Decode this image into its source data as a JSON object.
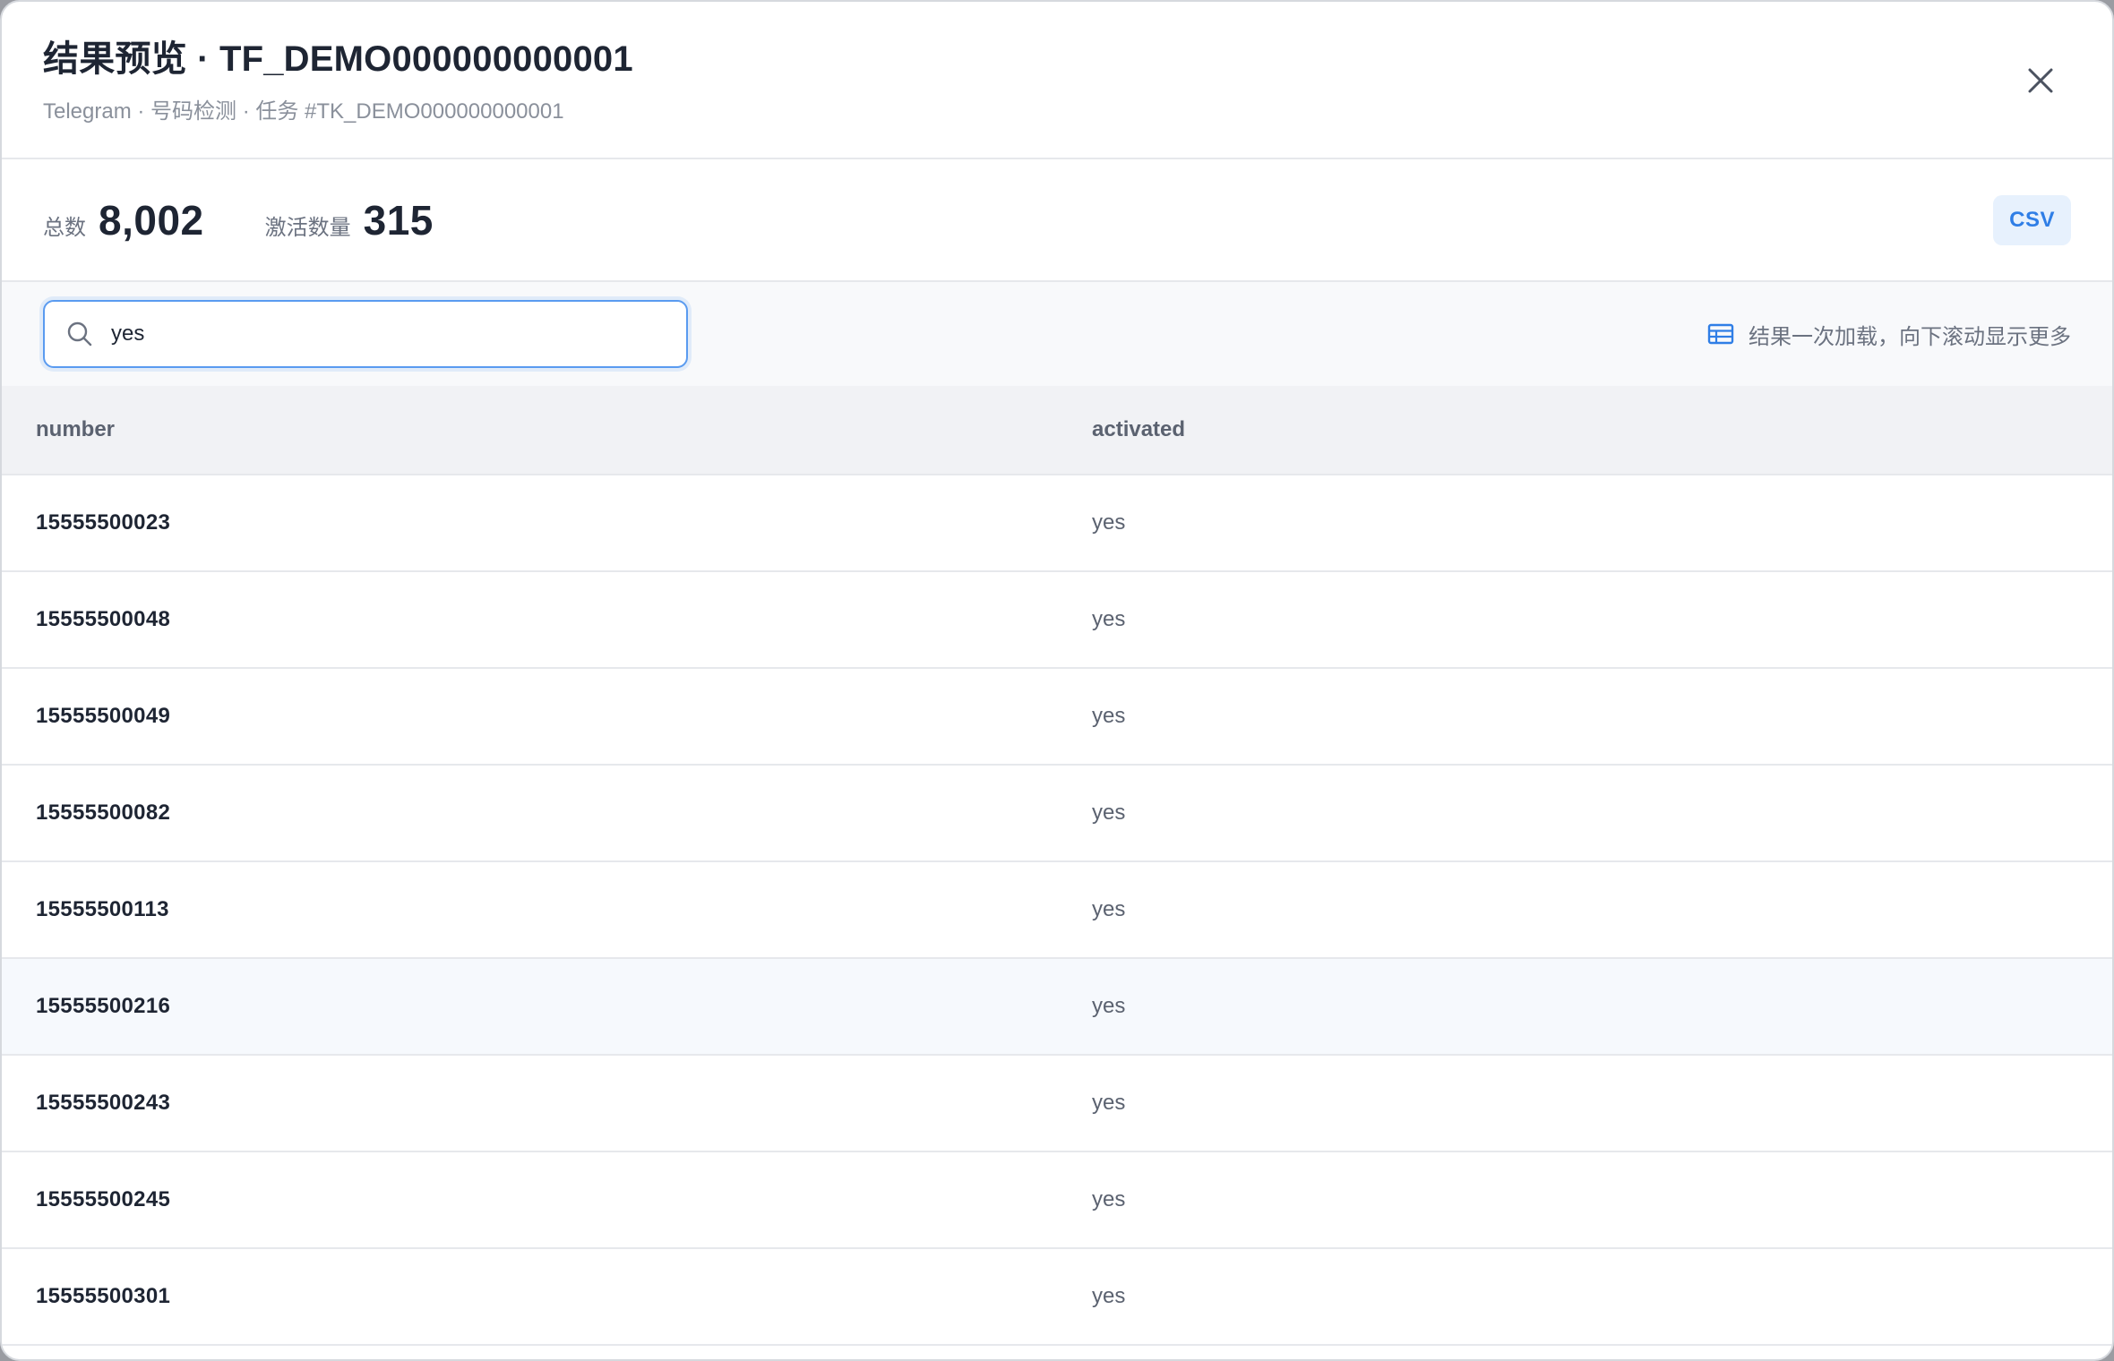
{
  "header": {
    "title": "结果预览 · TF_DEMO000000000001",
    "subtitle": "Telegram · 号码检测 · 任务 #TK_DEMO000000000001"
  },
  "stats": {
    "total_label": "总数",
    "total_value": "8,002",
    "activated_label": "激活数量",
    "activated_value": "315",
    "csv_label": "CSV"
  },
  "search": {
    "value": "yes",
    "hint": "结果一次加载，向下滚动显示更多"
  },
  "table": {
    "columns": [
      "number",
      "activated"
    ],
    "rows": [
      [
        "15555500023",
        "yes"
      ],
      [
        "15555500048",
        "yes"
      ],
      [
        "15555500049",
        "yes"
      ],
      [
        "15555500082",
        "yes"
      ],
      [
        "15555500113",
        "yes"
      ],
      [
        "15555500216",
        "yes"
      ],
      [
        "15555500243",
        "yes"
      ],
      [
        "15555500245",
        "yes"
      ],
      [
        "15555500301",
        "yes"
      ]
    ]
  },
  "colors": {
    "accent": "#2f7ee6",
    "text": "#1e2533",
    "muted": "#8a909b"
  },
  "icons": {
    "close": "close-icon",
    "search": "search-icon",
    "hint": "table-icon"
  }
}
